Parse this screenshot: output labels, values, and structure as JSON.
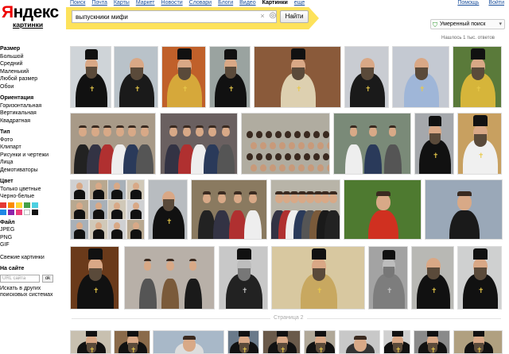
{
  "topnav": [
    "Поиск",
    "Почта",
    "Карты",
    "Маркет",
    "Новости",
    "Словари",
    "Блоги",
    "Видео",
    "Картинки",
    "еще"
  ],
  "topnav_active": "Картинки",
  "toplinks": [
    "Помощь",
    "Войти"
  ],
  "logo": {
    "brand_first": "Я",
    "brand_rest": "ндекс",
    "sub": "картинки"
  },
  "search": {
    "value": "выпускники мифи",
    "button": "Найти",
    "clear_glyph": "×",
    "camera_glyph": "◎"
  },
  "safe_search": {
    "label": "Умеренный поиск",
    "arrow": "▾"
  },
  "found": "Нашлось 1 тыс. ответов",
  "sidebar": {
    "size_heading": "Размер",
    "sizes": [
      "Большой",
      "Средний",
      "Маленький",
      "Любой размер",
      "Обои"
    ],
    "orientation_heading": "Ориентация",
    "orientations": [
      "Горизонтальная",
      "Вертикальная",
      "Квадратная"
    ],
    "type_heading": "Тип",
    "types": [
      "Фото",
      "Клипарт",
      "Рисунки и чертежи",
      "Лица",
      "Демотиваторы"
    ],
    "color_heading": "Цвет",
    "colors_options": [
      "Только цветные",
      "Черно-белые"
    ],
    "swatches": [
      "#e53935",
      "#fb8c00",
      "#fdd835",
      "#43a047",
      "#4dd0e1",
      "#1e88e5",
      "#8e24aa",
      "#ec407a",
      "#ffffff",
      "#111111"
    ],
    "file_heading": "Файл",
    "files": [
      "JPEG",
      "PNG",
      "GIF"
    ],
    "similar": "Свежие картинки",
    "site_heading": "На сайте",
    "site_placeholder": "URL сайта",
    "site_ok": "ok",
    "other_engines": "Искать в других поисковых системах"
  },
  "page_label": "Страница 2",
  "colors": {
    "accent": "#fde25b",
    "link": "#1a4f9c",
    "brand_red": "#e00000"
  }
}
